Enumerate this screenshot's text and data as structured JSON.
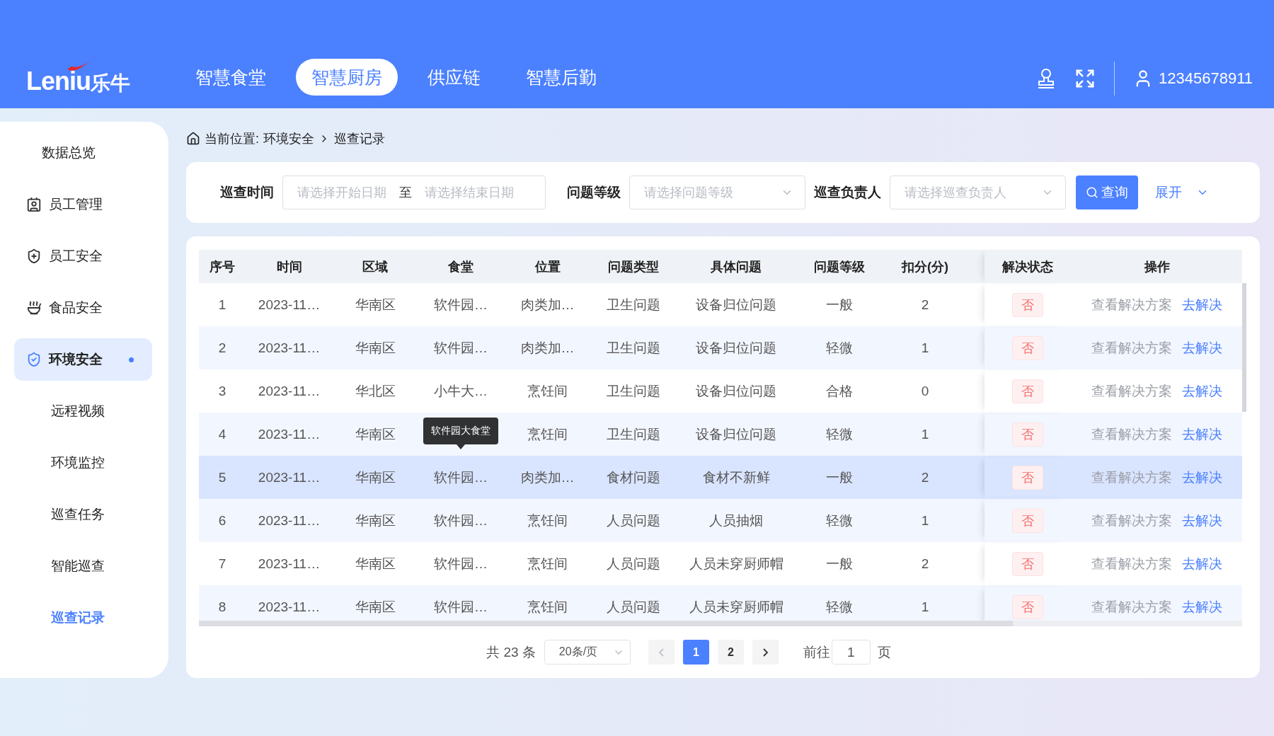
{
  "header": {
    "logo": {
      "latin": "Leniu",
      "cjk": "乐牛"
    },
    "nav": [
      {
        "label": "智慧食堂",
        "selected": false
      },
      {
        "label": "智慧厨房",
        "selected": true
      },
      {
        "label": "供应链",
        "selected": false
      },
      {
        "label": "智慧后勤",
        "selected": false
      }
    ],
    "user": "12345678911"
  },
  "sidebar": {
    "items": [
      {
        "label": "数据总览",
        "kind": "group",
        "selected": false,
        "expanded": false
      },
      {
        "label": "员工管理",
        "kind": "group",
        "selected": false,
        "expanded": false
      },
      {
        "label": "员工安全",
        "kind": "group",
        "selected": false,
        "expanded": false
      },
      {
        "label": "食品安全",
        "kind": "group",
        "selected": false,
        "expanded": false
      },
      {
        "label": "环境安全",
        "kind": "group",
        "selected": true,
        "expanded": true
      },
      {
        "label": "远程视频",
        "kind": "child",
        "selected": false,
        "expanded": false
      },
      {
        "label": "环境监控",
        "kind": "child",
        "selected": false,
        "expanded": false
      },
      {
        "label": "巡查任务",
        "kind": "child",
        "selected": false,
        "expanded": false
      },
      {
        "label": "智能巡查",
        "kind": "child",
        "selected": false,
        "expanded": false
      },
      {
        "label": "巡查记录",
        "kind": "child",
        "selected": true,
        "expanded": false
      }
    ]
  },
  "breadcrumb": {
    "label": "当前位置:",
    "path": [
      "环境安全",
      "巡查记录"
    ]
  },
  "filters": [
    {
      "kind": "daterange",
      "label": "巡查时间",
      "start_placeholder": "请选择开始日期",
      "separator": "至",
      "end_placeholder": "请选择结束日期"
    },
    {
      "kind": "select",
      "label": "问题等级",
      "placeholder": "请选择问题等级"
    },
    {
      "kind": "select",
      "label": "巡查负责人",
      "placeholder": "请选择巡查负责人"
    }
  ],
  "search_button": "查询",
  "expand_link": "展开",
  "table": {
    "columns": [
      "序号",
      "时间",
      "区域",
      "食堂",
      "位置",
      "问题类型",
      "具体问题",
      "问题等级",
      "扣分(分)",
      "解决状态",
      "操作"
    ],
    "rows": [
      {
        "index": "1",
        "time": "2023-11…",
        "region": "华南区",
        "canteen": "软件园…",
        "location": "肉类加…",
        "type": "卫生问题",
        "issue": "设备归位问题",
        "level": "一般",
        "score": "2",
        "status": "否",
        "actions": [
          "查看解决方案",
          "去解决"
        ],
        "selected": false
      },
      {
        "index": "2",
        "time": "2023-11…",
        "region": "华南区",
        "canteen": "软件园…",
        "location": "肉类加…",
        "type": "卫生问题",
        "issue": "设备归位问题",
        "level": "轻微",
        "score": "1",
        "status": "否",
        "actions": [
          "查看解决方案",
          "去解决"
        ],
        "selected": false
      },
      {
        "index": "3",
        "time": "2023-11…",
        "region": "华北区",
        "canteen": "小牛大…",
        "location": "烹饪间",
        "type": "卫生问题",
        "issue": "设备归位问题",
        "level": "合格",
        "score": "0",
        "status": "否",
        "actions": [
          "查看解决方案",
          "去解决"
        ],
        "selected": false
      },
      {
        "index": "4",
        "time": "2023-11…",
        "region": "华南区",
        "tooltip": "软件园大食堂",
        "location": "烹饪间",
        "type": "卫生问题",
        "issue": "设备归位问题",
        "level": "轻微",
        "score": "1",
        "status": "否",
        "actions": [
          "查看解决方案",
          "去解决"
        ],
        "selected": false
      },
      {
        "index": "5",
        "time": "2023-11…",
        "region": "华南区",
        "canteen": "软件园…",
        "location": "肉类加…",
        "type": "食材问题",
        "issue": "食材不新鲜",
        "level": "一般",
        "score": "2",
        "status": "否",
        "actions": [
          "查看解决方案",
          "去解决"
        ],
        "selected": true
      },
      {
        "index": "6",
        "time": "2023-11…",
        "region": "华南区",
        "canteen": "软件园…",
        "location": "烹饪间",
        "type": "人员问题",
        "issue": "人员抽烟",
        "level": "轻微",
        "score": "1",
        "status": "否",
        "actions": [
          "查看解决方案",
          "去解决"
        ],
        "selected": false
      },
      {
        "index": "7",
        "time": "2023-11…",
        "region": "华南区",
        "canteen": "软件园…",
        "location": "烹饪间",
        "type": "人员问题",
        "issue": "人员未穿厨师帽",
        "level": "一般",
        "score": "2",
        "status": "否",
        "actions": [
          "查看解决方案",
          "去解决"
        ],
        "selected": false
      },
      {
        "index": "8",
        "time": "2023-11…",
        "region": "华南区",
        "canteen": "软件园…",
        "location": "烹饪间",
        "type": "人员问题",
        "issue": "人员未穿厨师帽",
        "level": "轻微",
        "score": "1",
        "status": "否",
        "actions": [
          "查看解决方案",
          "去解决"
        ],
        "selected": false
      }
    ]
  },
  "pagination": {
    "total": "共 23 条",
    "page_size": "20条/页",
    "prev_disabled": true,
    "pages": [
      {
        "label": "1",
        "selected": true
      },
      {
        "label": "2",
        "selected": false
      }
    ],
    "goto_label": "前往",
    "goto_value": "1",
    "page_unit": "页"
  }
}
